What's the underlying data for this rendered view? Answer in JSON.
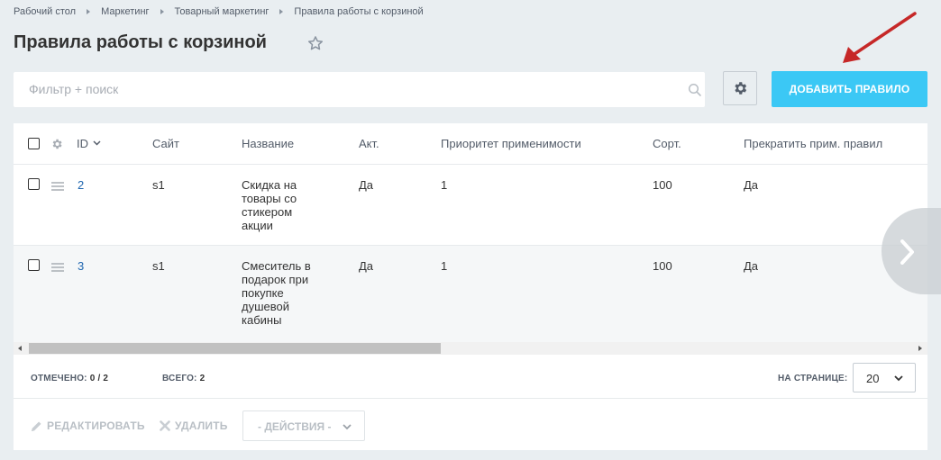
{
  "breadcrumbs": [
    "Рабочий стол",
    "Маркетинг",
    "Товарный маркетинг",
    "Правила работы с корзиной"
  ],
  "page": {
    "title": "Правила работы с корзиной"
  },
  "filter": {
    "placeholder": "Фильтр + поиск",
    "value": ""
  },
  "toolbar": {
    "add_button_label": "ДОБАВИТЬ ПРАВИЛО",
    "accent_color": "#3bc8f5"
  },
  "table": {
    "headers": {
      "id": "ID",
      "site": "Сайт",
      "name": "Название",
      "active": "Акт.",
      "priority": "Приоритет применимости",
      "sort": "Сорт.",
      "stop": "Прекратить прим. правил"
    },
    "rows": [
      {
        "id": "2",
        "site": "s1",
        "name": "Скидка на товары со стикером акции",
        "active": "Да",
        "priority": "1",
        "sort": "100",
        "stop": "Да"
      },
      {
        "id": "3",
        "site": "s1",
        "name": "Смеситель в подарок при покупке душевой кабины",
        "active": "Да",
        "priority": "1",
        "sort": "100",
        "stop": "Да"
      }
    ]
  },
  "footer": {
    "selected_label": "ОТМЕЧЕНО:",
    "selected_value": "0 / 2",
    "total_label": "ВСЕГО:",
    "total_value": "2",
    "per_page_label": "НА СТРАНИЦЕ:",
    "per_page_value": "20"
  },
  "actions": {
    "edit_label": "РЕДАКТИРОВАТЬ",
    "delete_label": "УДАЛИТЬ",
    "actions_select_label": "- ДЕЙСТВИЯ -"
  }
}
